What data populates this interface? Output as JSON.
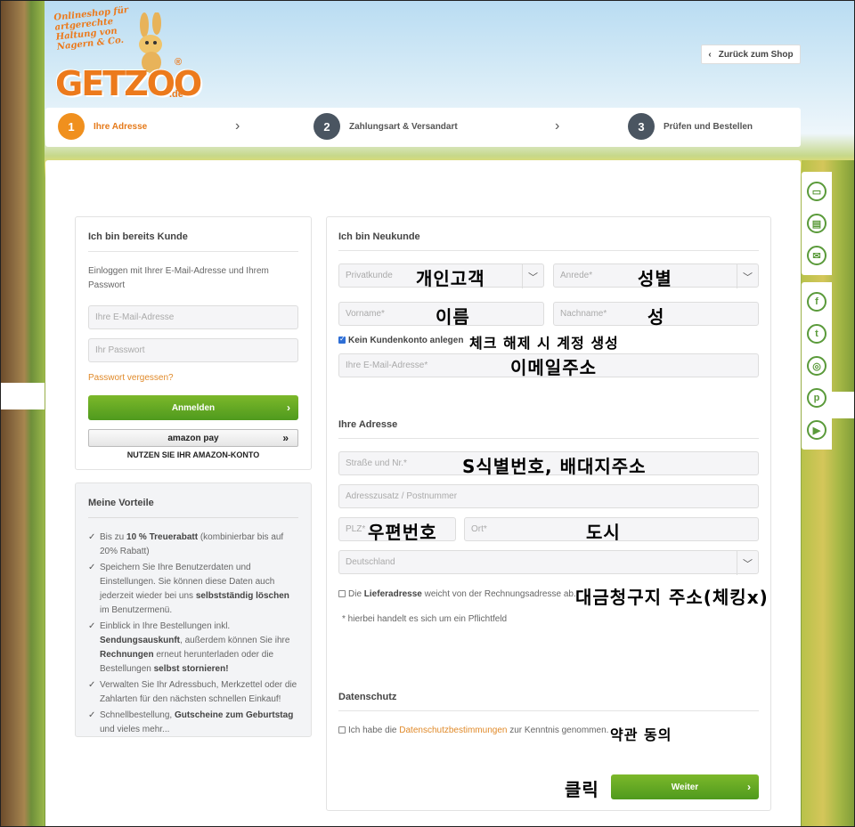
{
  "brand": {
    "tagline": "Onlineshop für artgerechte Haltung von Nagern & Co.",
    "name": "GETZOO",
    "domain": ".de",
    "reg": "®"
  },
  "header": {
    "back_label": "Zurück zum Shop"
  },
  "steps": [
    {
      "num": "1",
      "label": "Ihre Adresse",
      "active": true
    },
    {
      "num": "2",
      "label": "Zahlungsart & Versandart",
      "active": false
    },
    {
      "num": "3",
      "label": "Prüfen und Bestellen",
      "active": false
    }
  ],
  "login": {
    "title": "Ich bin bereits Kunde",
    "description": "Einloggen mit Ihrer E-Mail-Adresse und Ihrem Passwort",
    "email_placeholder": "Ihre E-Mail-Adresse",
    "password_placeholder": "Ihr Passwort",
    "forgot_label": "Passwort vergessen?",
    "submit_label": "Anmelden",
    "amazon_label": "amazon pay",
    "amazon_note": "NUTZEN SIE IHR AMAZON-KONTO"
  },
  "benefits": {
    "title": "Meine Vorteile",
    "items": [
      {
        "pre": "Bis zu ",
        "bold": "10 % Treuerabatt",
        "post": " (kombinierbar bis auf 20% Rabatt)"
      },
      {
        "pre": "Speichern Sie Ihre Benutzerdaten und Einstellungen. Sie können diese Daten auch jederzeit wieder bei uns ",
        "bold": "selbstständig löschen",
        "post": " im Benutzermenü."
      },
      {
        "pre": "Einblick in Ihre Bestellungen inkl. ",
        "bold": "Sendungsauskunft",
        "post": ", außerdem können Sie ihre ",
        "bold2": "Rechnungen",
        "post2": " erneut herunterladen oder die Bestellungen ",
        "bold3": "selbst stornieren!"
      },
      {
        "pre": "Verwalten Sie Ihr Adressbuch, Merkzettel oder die Zahlarten für den nächsten schnellen Einkauf!"
      },
      {
        "pre": "Schnellbestellung, ",
        "bold": "Gutscheine zum Geburtstag",
        "post": " und vieles mehr..."
      }
    ]
  },
  "register": {
    "title": "Ich bin Neukunde",
    "customer_type": "Privatkunde",
    "salutation": "Anrede*",
    "firstname_placeholder": "Vorname*",
    "lastname_placeholder": "Nachname*",
    "no_account_label": "Kein Kundenkonto anlegen",
    "email_placeholder": "Ihre E-Mail-Adresse*",
    "address_title": "Ihre Adresse",
    "street_placeholder": "Straße und Nr.*",
    "addition_placeholder": "Adresszusatz / Postnummer",
    "zip_placeholder": "PLZ*",
    "city_placeholder": "Ort*",
    "country": "Deutschland",
    "delivery_pre": "Die ",
    "delivery_bold": "Lieferadresse",
    "delivery_post": " weicht von der Rechnungsadresse ab.",
    "required_note": "* hierbei handelt es sich um ein Pflichtfeld",
    "privacy_title": "Datenschutz",
    "privacy_pre": "Ich habe die ",
    "privacy_link": "Datenschutzbestimmungen",
    "privacy_post": " zur Kenntnis genommen.",
    "submit_label": "Weiter"
  },
  "annotations": {
    "customer_type": "개인고객",
    "salutation": "성별",
    "firstname": "이름",
    "lastname": "성",
    "no_account": "체크 해제 시 계정 생성",
    "email": "이메일주소",
    "street": "S식별번호, 배대지주소",
    "zip": "우편번호",
    "city": "도시",
    "delivery": "대금청구지 주소(체킹x)",
    "privacy": "약관 동의",
    "click": "클릭"
  },
  "side_icons": [
    "truck-icon",
    "wallet-icon",
    "mail-icon",
    "facebook-icon",
    "twitter-icon",
    "instagram-icon",
    "pinterest-icon",
    "youtube-icon"
  ],
  "colors": {
    "accent": "#f0901e",
    "green": "#5a9a1e",
    "step_dark": "#4a5561"
  }
}
